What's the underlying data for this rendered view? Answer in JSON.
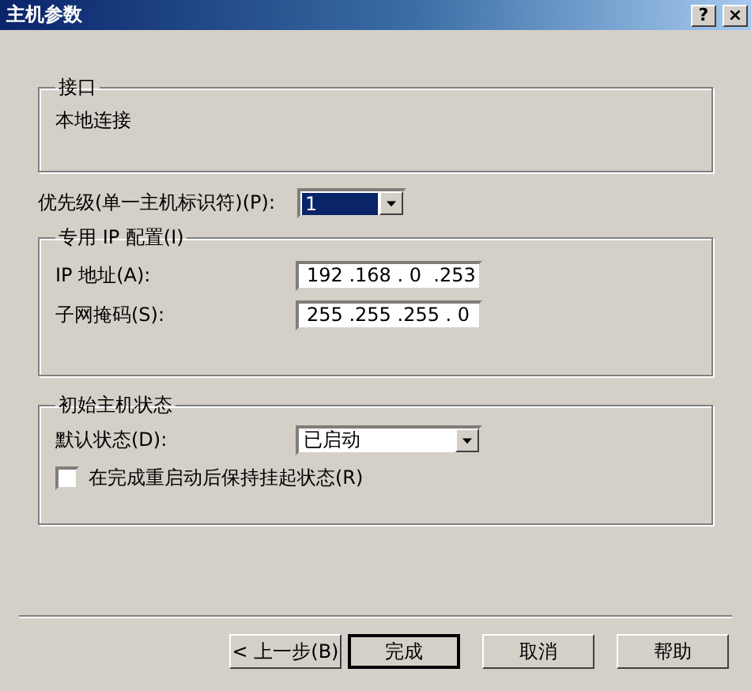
{
  "window": {
    "title": "主机参数",
    "buttons": [
      {
        "kind": "help",
        "label": "?"
      },
      {
        "kind": "close",
        "label": "×"
      }
    ]
  },
  "interface_group": {
    "title": "接口",
    "value": "本地连接"
  },
  "priority": {
    "label": "优先级(单一主机标识符)(P):",
    "value": "1",
    "focused": true
  },
  "ip_group": {
    "title": "专用 IP 配置(I)",
    "fields": [
      {
        "label": "IP 地址(A):",
        "value": "192 .168 . 0  .253"
      },
      {
        "label": "子网掩码(S):",
        "value": "255 .255 .255 . 0"
      }
    ]
  },
  "state_group": {
    "title": "初始主机状态",
    "default_state": {
      "label": "默认状态(D):",
      "value": "已启动"
    },
    "keep_suspended": {
      "label": "在完成重启动后保持挂起状态(R)",
      "checked": false
    }
  },
  "buttons": [
    {
      "label": "< 上一步(B)",
      "default": false
    },
    {
      "label": "完成",
      "default": true
    },
    {
      "label": "取消",
      "default": false
    },
    {
      "label": "帮助",
      "default": false
    }
  ]
}
